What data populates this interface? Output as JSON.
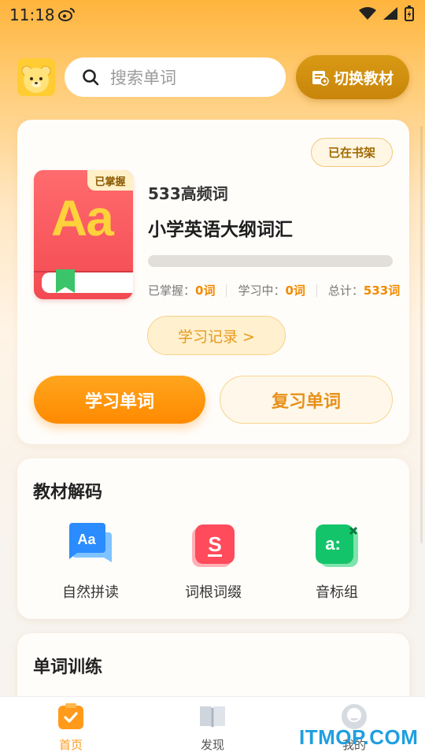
{
  "status_bar": {
    "time": "11:18"
  },
  "header": {
    "search_placeholder": "搜索单词",
    "switch_button": "切换教材"
  },
  "book": {
    "shelf_tag": "已在书架",
    "cover_badge": "已掌握",
    "cover_text": "Aa",
    "subtitle": "533高频词",
    "title": "小学英语大纲词汇",
    "progress": 0,
    "stats": [
      {
        "label": "已掌握：",
        "value": "0词"
      },
      {
        "label": "学习中：",
        "value": "0词"
      },
      {
        "label": "总计：",
        "value": "533词"
      }
    ],
    "record_button": "学习记录 >",
    "study_button": "学习单词",
    "review_button": "复习单词"
  },
  "decode": {
    "title": "教材解码",
    "tools": [
      {
        "label": "自然拼读",
        "icon": "aa-chat-icon",
        "color": "#2a8cff"
      },
      {
        "label": "词根词缀",
        "icon": "s-card-icon",
        "color": "#ff4b5c"
      },
      {
        "label": "音标组",
        "icon": "phonetic-icon",
        "color": "#14c46a"
      }
    ]
  },
  "training": {
    "title": "单词训练"
  },
  "bottom_nav": {
    "items": [
      {
        "label": "首页",
        "icon": "home-check-icon",
        "active": true
      },
      {
        "label": "发现",
        "icon": "book-open-icon",
        "active": false
      },
      {
        "label": "我的",
        "icon": "user-icon",
        "active": false
      }
    ]
  },
  "watermark": "ITMOP.COM",
  "colors": {
    "accent": "#ff9a1a",
    "primary_text": "#222222"
  }
}
